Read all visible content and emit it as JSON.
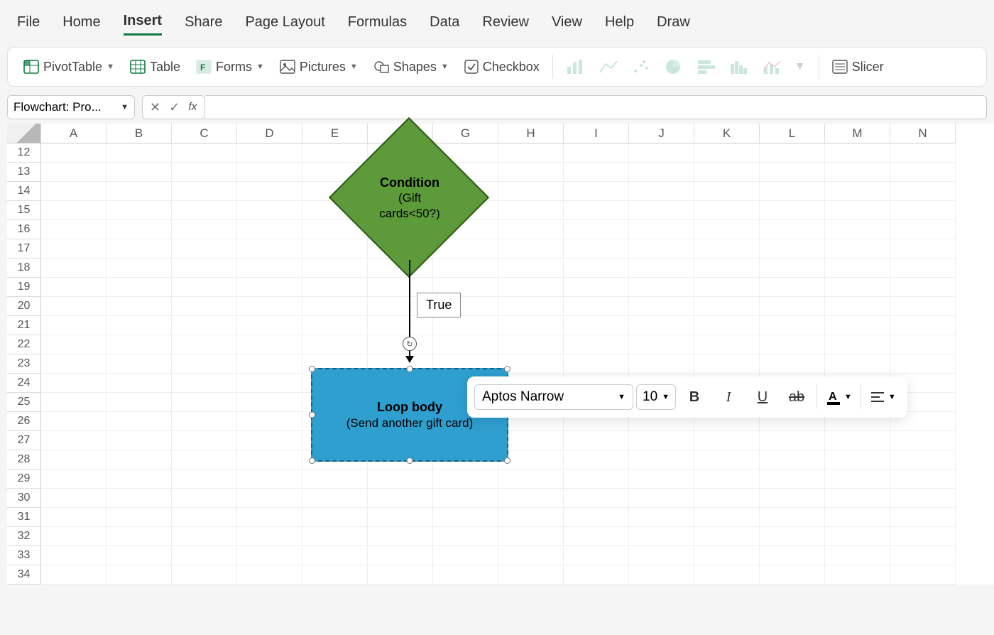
{
  "menu": {
    "items": [
      "File",
      "Home",
      "Insert",
      "Share",
      "Page Layout",
      "Formulas",
      "Data",
      "Review",
      "View",
      "Help",
      "Draw"
    ],
    "active": "Insert"
  },
  "ribbon": {
    "pivotTable": "PivotTable",
    "table": "Table",
    "forms": "Forms",
    "pictures": "Pictures",
    "shapes": "Shapes",
    "checkbox": "Checkbox",
    "slicer": "Slicer"
  },
  "nameBox": "Flowchart: Pro...",
  "columns": [
    "A",
    "B",
    "C",
    "D",
    "E",
    "F",
    "G",
    "H",
    "I",
    "J",
    "K",
    "L",
    "M",
    "N"
  ],
  "rowStart": 12,
  "rowEnd": 34,
  "flowchart": {
    "conditionTitle": "Condition",
    "conditionLine1": "(Gift",
    "conditionLine2": "cards<50?)",
    "edgeLabel": "True",
    "processTitle": "Loop body",
    "processSub": "(Send another gift card)"
  },
  "miniToolbar": {
    "font": "Aptos Narrow",
    "size": "10"
  },
  "colors": {
    "accentGreen": "#107c41",
    "diamondFill": "#5d9b3a",
    "diamondStroke": "#2e5a17",
    "processFill": "#2f9fd0",
    "processStroke": "#1a5d7e"
  }
}
